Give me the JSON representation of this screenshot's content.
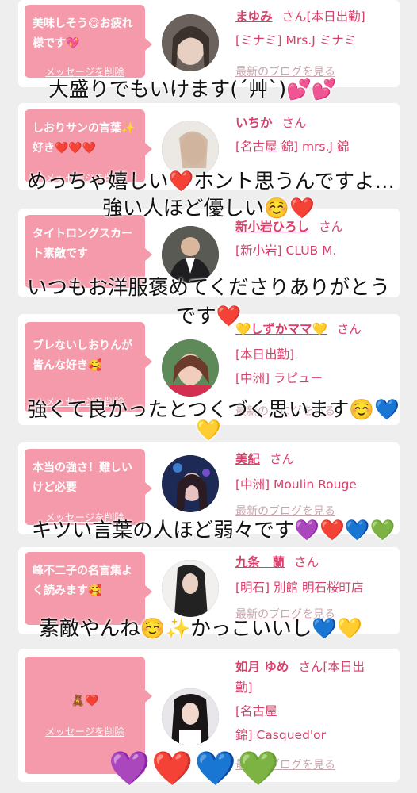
{
  "delete_label": "メッセージを削除",
  "blog_label": "最新のブログを見る",
  "san": "さん",
  "cards": [
    {
      "message": "美味しそう😋お疲れ様です💖",
      "name": "まゆみ",
      "tag": "[本日出勤]",
      "store1": "[ミナミ] Mrs.J ミナミ",
      "store2": ""
    },
    {
      "message": "しおりサンの言葉✨好き❤️❤️❤️",
      "name": "いちか",
      "tag": "",
      "store1": "[名古屋 錦] mrs.J 錦",
      "store2": ""
    },
    {
      "message": "タイトロングスカート素敵です",
      "name": "新小岩ひろし",
      "tag": "",
      "store1": "[新小岩] CLUB M.",
      "store2": ""
    },
    {
      "message": "ブレないしおりんが皆んな好き🥰",
      "name": "💛しずかママ💛",
      "tag": "",
      "store1": "[本日出勤]",
      "store2": "[中洲] ラピュー"
    },
    {
      "message": "本当の強さ！難しいけど必要",
      "name": "美紀",
      "tag": "",
      "store1": "[中洲] Moulin Rouge",
      "store2": ""
    },
    {
      "message": "峰不二子の名言集よく読みます🥰",
      "name": "九条　蘭",
      "tag": "",
      "store1": "[明石] 別館 明石桜町店",
      "store2": ""
    },
    {
      "message": "🧸❤️",
      "name": "如月 ゆめ",
      "tag": "[本日出",
      "tag2": "勤]",
      "store1": "[名古屋",
      "store2": "錦] Casqued'or"
    }
  ],
  "overlays": [
    "大盛りでもいけます(´艸`)💕💕",
    "めっちゃ嬉しい❤️ホント思うんですよ…",
    "強い人ほど優しい☺️❤️",
    "いつもお洋服褒めてくださりありがとう",
    "です❤️",
    "強くて良かったとつくづく思います☺️💙",
    "💛",
    "キツい言葉の人ほど弱々です💜❤️💙💚",
    "素敵やんね☺️✨かっこいいし💙💛"
  ],
  "big_hearts": "💜❤️💙💚",
  "colors": {
    "pink_bubble": "#f59aaa",
    "name_pink": "#d6406a",
    "background": "#eeeeee"
  }
}
